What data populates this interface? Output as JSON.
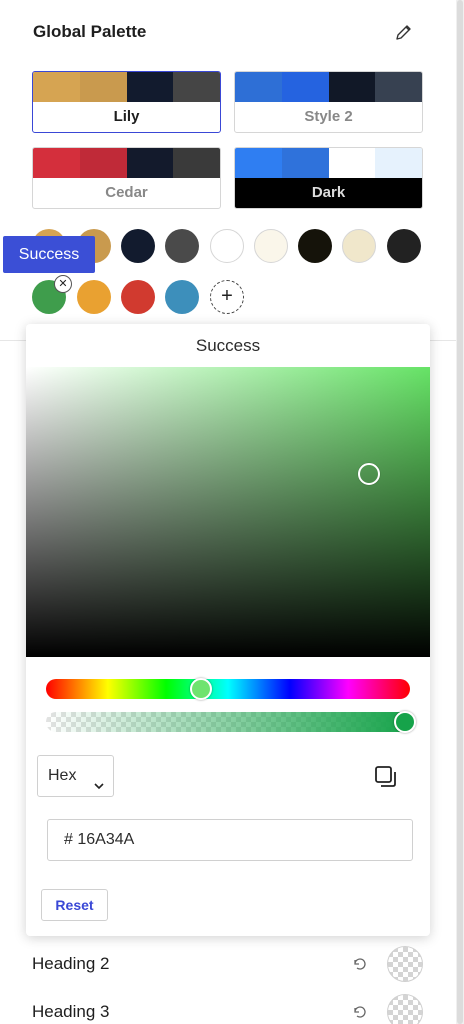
{
  "header": {
    "title": "Global Palette",
    "edit_icon": "pencil-icon"
  },
  "palettes": [
    {
      "name": "Lily",
      "selected": true,
      "colors": [
        "#d6a452",
        "#c99a4e",
        "#121b2e",
        "#454545"
      ]
    },
    {
      "name": "Style 2",
      "selected": false,
      "colors": [
        "#2e6fd6",
        "#2563e0",
        "#111827",
        "#374151"
      ]
    },
    {
      "name": "Cedar",
      "selected": false,
      "colors": [
        "#d42f3c",
        "#c02a38",
        "#131a2c",
        "#3a3a3a"
      ]
    },
    {
      "name": "Dark",
      "selected": false,
      "colors": [
        "#2f7ef2",
        "#2f72db",
        "#ffffff",
        "#e6f2fd"
      ]
    }
  ],
  "swatches": [
    {
      "color": "#d6a452"
    },
    {
      "color": "#c99a4e"
    },
    {
      "color": "#121b2e"
    },
    {
      "color": "#4a4a4a"
    },
    {
      "color": "#ffffff"
    },
    {
      "color": "#faf6ea"
    },
    {
      "color": "#15130a"
    },
    {
      "color": "#f0e7cb"
    },
    {
      "color": "#222222"
    },
    {
      "color": "#3f9d4c"
    },
    {
      "color": "#e9a131"
    },
    {
      "color": "#d13a2f"
    },
    {
      "color": "#3d8fbb"
    }
  ],
  "tooltip": {
    "text": "Success"
  },
  "picker": {
    "title": "Success",
    "format": "Hex",
    "hex_value": "# 16A34A",
    "reset_label": "Reset",
    "alpha_percent": 100,
    "color": "#16a34a"
  },
  "rows": [
    {
      "label": "Heading 2"
    },
    {
      "label": "Heading 3"
    }
  ]
}
